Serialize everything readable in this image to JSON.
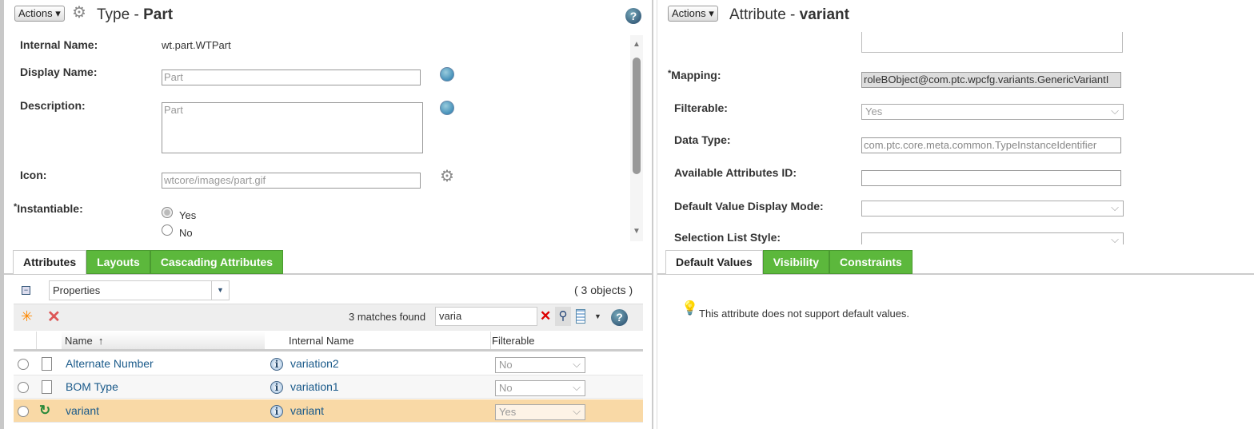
{
  "left": {
    "actions_label": "Actions",
    "title_prefix": "Type - ",
    "title_name": "Part",
    "fields": {
      "internal_name_label": "Internal Name:",
      "internal_name_value": "wt.part.WTPart",
      "display_name_label": "Display Name:",
      "display_name_value": "Part",
      "description_label": "Description:",
      "description_value": "Part",
      "icon_label": "Icon:",
      "icon_value": "wtcore/images/part.gif",
      "instantiable_label": "Instantiable:",
      "instantiable_yes": "Yes",
      "instantiable_no": "No",
      "instantiable_selected": "Yes"
    },
    "tabs": [
      {
        "label": "Attributes",
        "active": true
      },
      {
        "label": "Layouts"
      },
      {
        "label": "Cascading Attributes"
      }
    ],
    "view_select": "Properties",
    "object_count": "( 3 objects )",
    "matches": "3 matches found",
    "filter_value": "varia",
    "columns": {
      "name": "Name",
      "sort": "↑",
      "internal": "Internal Name",
      "filterable": "Filterable"
    },
    "rows": [
      {
        "name": "Alternate Number",
        "internal": "variation2",
        "filterable": "No",
        "icon": "document-icon",
        "selected": false
      },
      {
        "name": "BOM Type",
        "internal": "variation1",
        "filterable": "No",
        "icon": "document-icon",
        "selected": false
      },
      {
        "name": "variant",
        "internal": "variant",
        "filterable": "Yes",
        "icon": "variant-icon",
        "selected": true
      }
    ]
  },
  "right": {
    "actions_label": "Actions",
    "title_prefix": "Attribute - ",
    "title_name": "variant",
    "fields": {
      "mapping_label": "Mapping:",
      "mapping_value": "roleBObject@com.ptc.wpcfg.variants.GenericVariantI",
      "filterable_label": "Filterable:",
      "filterable_value": "Yes",
      "data_type_label": "Data Type:",
      "data_type_value": "com.ptc.core.meta.common.TypeInstanceIdentifier",
      "available_id_label": "Available Attributes ID:",
      "available_id_value": "",
      "default_display_label": "Default Value Display Mode:",
      "selection_style_label": "Selection List Style:"
    },
    "tabs": [
      {
        "label": "Default Values",
        "active": true
      },
      {
        "label": "Visibility"
      },
      {
        "label": "Constraints"
      }
    ],
    "message": "This attribute does not support default values."
  },
  "colors": {
    "tab_green": "#5cb83c",
    "selected_row": "#f9d9a6",
    "link": "#1a5a8a"
  }
}
